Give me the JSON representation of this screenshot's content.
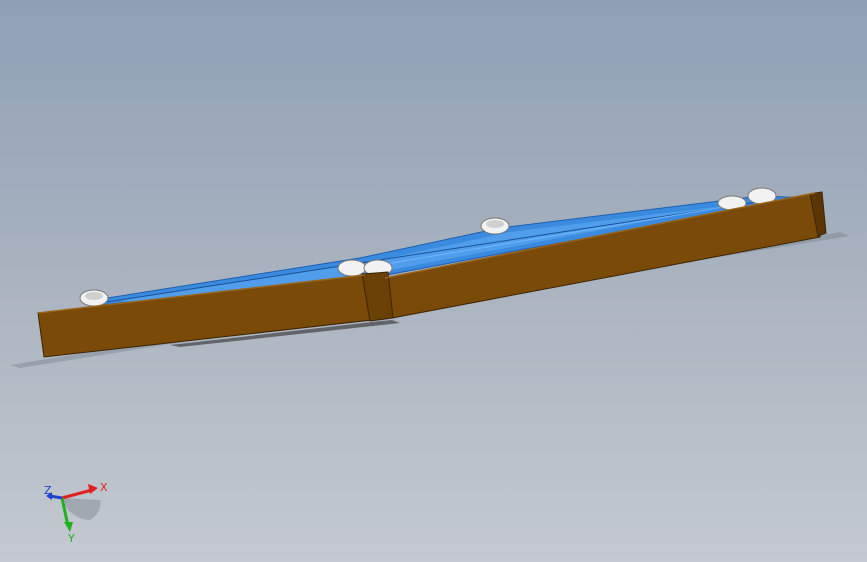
{
  "viewport": {
    "background_top": "#8fa0b6",
    "background_bottom": "#c4c9d0"
  },
  "model": {
    "frame_color": "#7a4a08",
    "frame_dark": "#4e2f05",
    "panel_color": "#3a8ae0",
    "roller_color": "#e8e8e8"
  },
  "triad": {
    "x_label": "X",
    "y_label": "Y",
    "z_label": "Z",
    "x_color": "#e02020",
    "y_color": "#20b020",
    "z_color": "#2040d0"
  }
}
